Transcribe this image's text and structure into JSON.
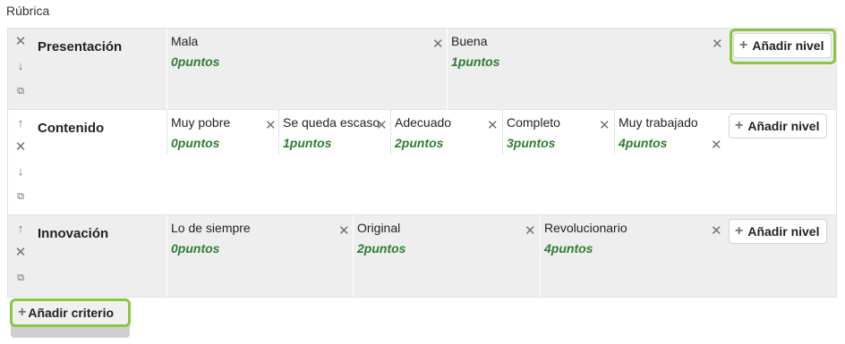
{
  "page": {
    "title": "Rúbrica"
  },
  "rubric": {
    "criteria": [
      {
        "name": "Presentación",
        "levels": [
          {
            "definition": "Mala",
            "points": "0puntos"
          },
          {
            "definition": "Buena",
            "points": "1puntos"
          }
        ]
      },
      {
        "name": "Contenido",
        "levels": [
          {
            "definition": "Muy pobre",
            "points": "0puntos"
          },
          {
            "definition": "Se queda escaso",
            "points": "1puntos"
          },
          {
            "definition": "Adecuado",
            "points": "2puntos"
          },
          {
            "definition": "Completo",
            "points": "3puntos"
          },
          {
            "definition": "Muy trabajado",
            "points": "4puntos"
          }
        ]
      },
      {
        "name": "Innovación",
        "levels": [
          {
            "definition": "Lo de siempre",
            "points": "0puntos"
          },
          {
            "definition": "Original",
            "points": "2puntos"
          },
          {
            "definition": "Revolucionario",
            "points": "4puntos"
          }
        ]
      }
    ],
    "add_level_label": "Añadir nivel",
    "add_criterion_label": "Añadir criterio"
  },
  "icons": {
    "delete": "close-icon",
    "move_up": "arrow-up-icon",
    "move_down": "arrow-down-icon",
    "duplicate": "duplicate-icon",
    "add": "plus-icon"
  },
  "colors": {
    "points": "#2e7d32",
    "highlight": "#8dc63f",
    "row_shaded": "#eeeeee"
  }
}
